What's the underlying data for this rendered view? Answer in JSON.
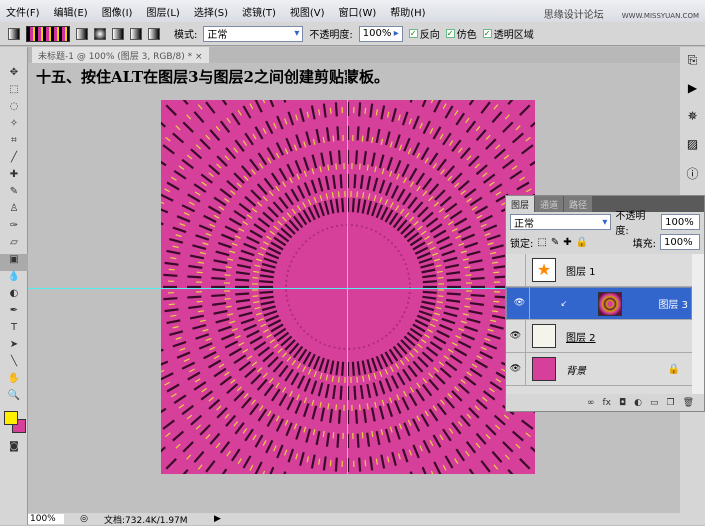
{
  "menu": [
    "文件(F)",
    "编辑(E)",
    "图像(I)",
    "图层(L)",
    "选择(S)",
    "滤镜(T)",
    "视图(V)",
    "窗口(W)",
    "帮助(H)"
  ],
  "watermark": {
    "cn": "思缘设计论坛",
    "url": "WWW.MISSYUAN.COM"
  },
  "options": {
    "mode_label": "模式:",
    "mode_value": "正常",
    "opacity_label": "不透明度:",
    "opacity_value": "100%",
    "reverse": "反向",
    "dither": "仿色",
    "transparency": "透明区域"
  },
  "document": {
    "tab": "未标题-1 @ 100% (图层 3, RGB/8) *",
    "close": "×"
  },
  "instruction": "十五、按住ALT在图层3与图层2之间创建剪贴蒙板。",
  "status": {
    "zoom": "100%",
    "doc": "文档:732.4K/1.97M"
  },
  "layers_panel": {
    "tabs": [
      "图层",
      "通道",
      "路径"
    ],
    "blend": "正常",
    "opacity_label": "不透明度:",
    "opacity": "100%",
    "lock_label": "锁定:",
    "fill_label": "填充:",
    "fill": "100%",
    "layers": [
      {
        "name": "图层 1",
        "visible": false
      },
      {
        "name": "图层 3",
        "visible": true,
        "selected": true
      },
      {
        "name": "图层 2",
        "visible": true
      },
      {
        "name": "背景",
        "visible": true,
        "locked": true
      }
    ],
    "bottom_icons": [
      "link-icon",
      "fx",
      "mask-icon",
      "adjustment-icon",
      "group-icon",
      "new-layer-icon",
      "trash-icon"
    ]
  },
  "colors": {
    "foreground": "#ffee00",
    "background": "#d6409a",
    "canvas": "#d6409a"
  }
}
